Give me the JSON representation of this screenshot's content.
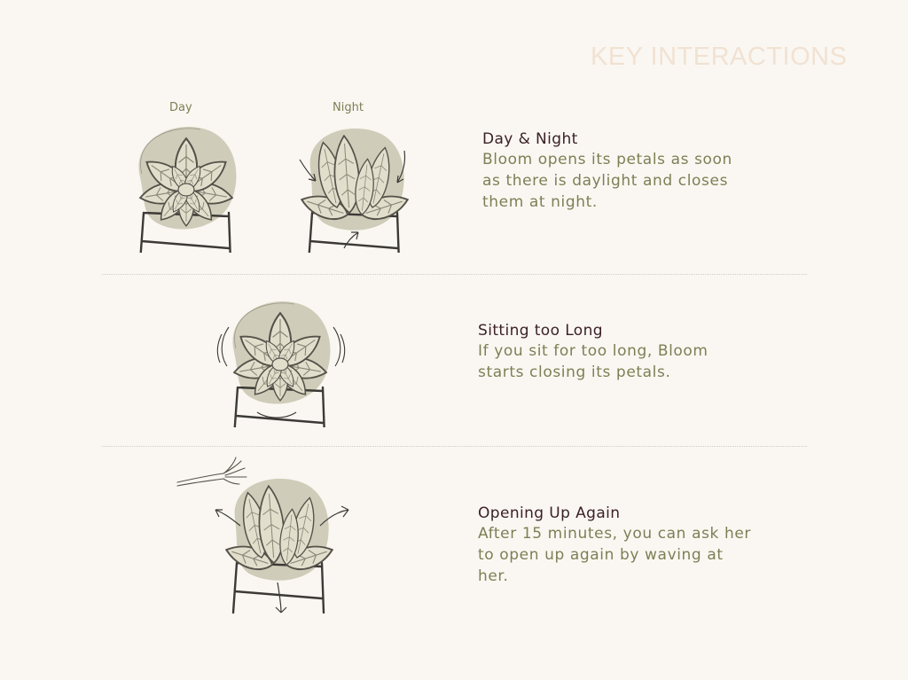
{
  "page": {
    "title": "KEY INTERACTIONS"
  },
  "sections": [
    {
      "heading": "Day & Night",
      "body": [
        "Bloom opens its petals as soon",
        "as there is daylight and closes",
        "them at night."
      ],
      "captions": [
        "Day",
        "Night"
      ]
    },
    {
      "heading": "Sitting too Long",
      "body": [
        "If you sit for too long, Bloom",
        "starts closing its petals."
      ]
    },
    {
      "heading": "Opening Up Again",
      "body": [
        "After 15 minutes, you can ask her",
        "to open up again by waving at",
        "her."
      ]
    }
  ],
  "colors": {
    "background": "#faf7f2",
    "title": "#f1e2d2",
    "heading": "#3b2128",
    "body": "#7d7f55",
    "blob": "#cfcdb9",
    "petal": "#e1decc",
    "stroke": "#55524a"
  }
}
